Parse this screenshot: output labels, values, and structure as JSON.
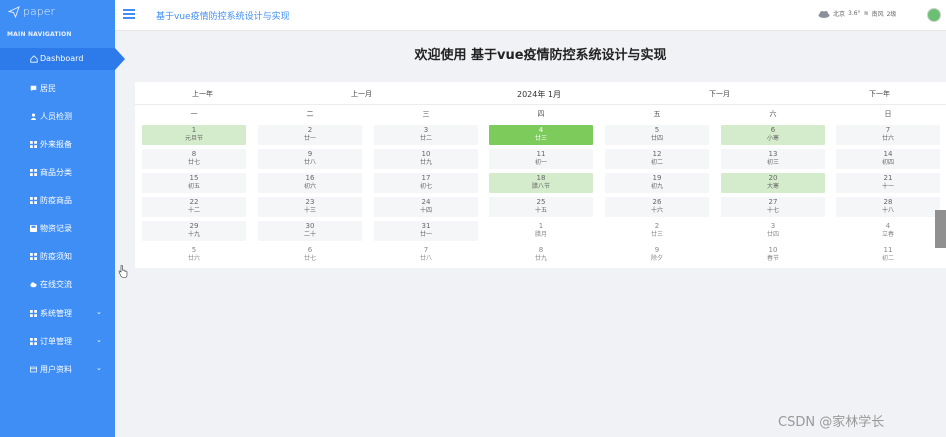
{
  "logo": {
    "text": "paper"
  },
  "sidebar": {
    "section_title": "MAIN NAVIGATION",
    "items": [
      {
        "label": "Dashboard",
        "icon": "home-icon"
      },
      {
        "label": "居民",
        "icon": "message-icon"
      },
      {
        "label": "人员检测",
        "icon": "user-icon"
      },
      {
        "label": "外来报备",
        "icon": "grid-icon"
      },
      {
        "label": "商品分类",
        "icon": "grid-icon"
      },
      {
        "label": "防疫商品",
        "icon": "grid-icon"
      },
      {
        "label": "物资记录",
        "icon": "save-icon"
      },
      {
        "label": "防疫须知",
        "icon": "grid-icon"
      },
      {
        "label": "在线交流",
        "icon": "cloud-icon"
      },
      {
        "label": "系统管理",
        "icon": "grid-icon"
      },
      {
        "label": "订单管理",
        "icon": "grid-icon"
      },
      {
        "label": "用户资料",
        "icon": "card-icon"
      }
    ]
  },
  "header": {
    "title": "基于vue疫情防控系统设计与实现",
    "weather": {
      "city": "北京",
      "temp": "3.6°",
      "wind": "南风",
      "level": "2级"
    }
  },
  "welcome": "欢迎使用 基于vue疫情防控系统设计与实现",
  "calendar": {
    "prev_year": "上一年",
    "prev_month": "上一月",
    "current": "2024年 1月",
    "next_month": "下一月",
    "next_year": "下一年",
    "weekdays": [
      "一",
      "二",
      "三",
      "四",
      "五",
      "六",
      "日"
    ],
    "weeks": [
      [
        {
          "n": "1",
          "l": "元旦节",
          "s": "hl"
        },
        {
          "n": "2",
          "l": "廿一"
        },
        {
          "n": "3",
          "l": "廿二"
        },
        {
          "n": "4",
          "l": "廿三",
          "s": "today"
        },
        {
          "n": "5",
          "l": "廿四"
        },
        {
          "n": "6",
          "l": "小寒",
          "s": "hl"
        },
        {
          "n": "7",
          "l": "廿六"
        }
      ],
      [
        {
          "n": "8",
          "l": "廿七"
        },
        {
          "n": "9",
          "l": "廿八"
        },
        {
          "n": "10",
          "l": "廿九"
        },
        {
          "n": "11",
          "l": "初一"
        },
        {
          "n": "12",
          "l": "初二"
        },
        {
          "n": "13",
          "l": "初三"
        },
        {
          "n": "14",
          "l": "初四"
        }
      ],
      [
        {
          "n": "15",
          "l": "初五"
        },
        {
          "n": "16",
          "l": "初六"
        },
        {
          "n": "17",
          "l": "初七"
        },
        {
          "n": "18",
          "l": "腊八节",
          "s": "hl"
        },
        {
          "n": "19",
          "l": "初九"
        },
        {
          "n": "20",
          "l": "大寒",
          "s": "hl"
        },
        {
          "n": "21",
          "l": "十一"
        }
      ],
      [
        {
          "n": "22",
          "l": "十二"
        },
        {
          "n": "23",
          "l": "十三"
        },
        {
          "n": "24",
          "l": "十四"
        },
        {
          "n": "25",
          "l": "十五"
        },
        {
          "n": "26",
          "l": "十六"
        },
        {
          "n": "27",
          "l": "十七"
        },
        {
          "n": "28",
          "l": "十八"
        }
      ],
      [
        {
          "n": "29",
          "l": "十九"
        },
        {
          "n": "30",
          "l": "二十"
        },
        {
          "n": "31",
          "l": "廿一"
        },
        {
          "n": "1",
          "l": "腊月",
          "s": "out"
        },
        {
          "n": "2",
          "l": "廿三",
          "s": "out"
        },
        {
          "n": "3",
          "l": "廿四",
          "s": "out"
        },
        {
          "n": "4",
          "l": "立春",
          "s": "out"
        }
      ],
      [
        {
          "n": "5",
          "l": "廿六",
          "s": "out"
        },
        {
          "n": "6",
          "l": "廿七",
          "s": "out"
        },
        {
          "n": "7",
          "l": "廿八",
          "s": "out"
        },
        {
          "n": "8",
          "l": "廿九",
          "s": "out"
        },
        {
          "n": "9",
          "l": "除夕",
          "s": "out"
        },
        {
          "n": "10",
          "l": "春节",
          "s": "out"
        },
        {
          "n": "11",
          "l": "初二",
          "s": "out"
        }
      ]
    ]
  },
  "watermark": "CSDN @家林学长",
  "colors": {
    "sidebar": "#3f8ef5",
    "active": "#2d7bea",
    "today": "#7ccb5b",
    "holiday": "#d5eccc"
  }
}
